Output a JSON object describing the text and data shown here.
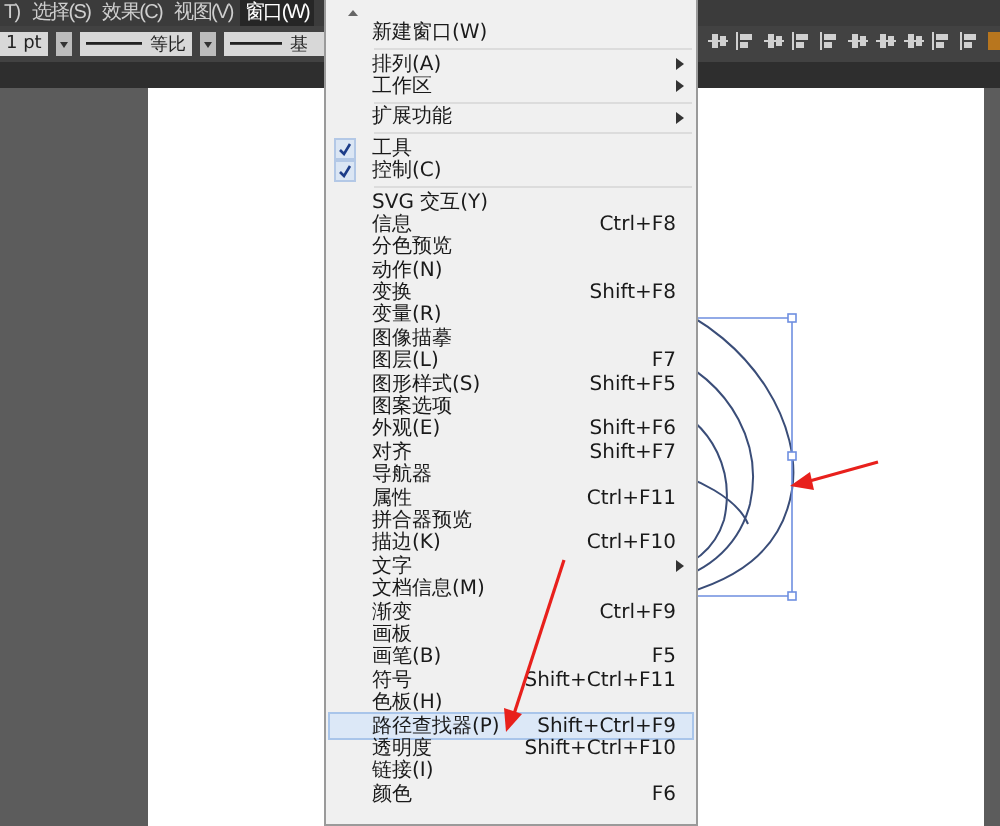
{
  "menu_bar": [
    {
      "label": "T)",
      "selected": false
    },
    {
      "label": "选择(S)",
      "selected": false
    },
    {
      "label": "效果(C)",
      "selected": false
    },
    {
      "label": "视图(V)",
      "selected": false
    },
    {
      "label": "窗口(W)",
      "selected": true
    }
  ],
  "control_bar": {
    "stroke_weight": "1 pt",
    "profile": "等比",
    "brush": "基"
  },
  "menu": {
    "items": [
      {
        "kind": "item",
        "label": "新建窗口(W)",
        "checked": false,
        "submenu": false,
        "selected": false
      },
      {
        "kind": "separator"
      },
      {
        "kind": "item",
        "label": "排列(A)",
        "checked": false,
        "submenu": true,
        "selected": false
      },
      {
        "kind": "item",
        "label": "工作区",
        "checked": false,
        "submenu": true,
        "selected": false
      },
      {
        "kind": "separator"
      },
      {
        "kind": "item",
        "label": "扩展功能",
        "checked": false,
        "submenu": true,
        "selected": false
      },
      {
        "kind": "separator"
      },
      {
        "kind": "item",
        "label": "工具",
        "checked": true,
        "submenu": false,
        "selected": false
      },
      {
        "kind": "item",
        "label": "控制(C)",
        "checked": true,
        "submenu": false,
        "selected": false
      },
      {
        "kind": "separator"
      },
      {
        "kind": "item",
        "label": "SVG 交互(Y)",
        "checked": false,
        "submenu": false,
        "selected": false
      },
      {
        "kind": "item",
        "label": "信息",
        "shortcut": "Ctrl+F8",
        "checked": false,
        "submenu": false,
        "selected": false
      },
      {
        "kind": "item",
        "label": "分色预览",
        "checked": false,
        "submenu": false,
        "selected": false
      },
      {
        "kind": "item",
        "label": "动作(N)",
        "checked": false,
        "submenu": false,
        "selected": false
      },
      {
        "kind": "item",
        "label": "变换",
        "shortcut": "Shift+F8",
        "checked": false,
        "submenu": false,
        "selected": false
      },
      {
        "kind": "item",
        "label": "变量(R)",
        "checked": false,
        "submenu": false,
        "selected": false
      },
      {
        "kind": "item",
        "label": "图像描摹",
        "checked": false,
        "submenu": false,
        "selected": false
      },
      {
        "kind": "item",
        "label": "图层(L)",
        "shortcut": "F7",
        "checked": false,
        "submenu": false,
        "selected": false
      },
      {
        "kind": "item",
        "label": "图形样式(S)",
        "shortcut": "Shift+F5",
        "checked": false,
        "submenu": false,
        "selected": false
      },
      {
        "kind": "item",
        "label": "图案选项",
        "checked": false,
        "submenu": false,
        "selected": false
      },
      {
        "kind": "item",
        "label": "外观(E)",
        "shortcut": "Shift+F6",
        "checked": false,
        "submenu": false,
        "selected": false
      },
      {
        "kind": "item",
        "label": "对齐",
        "shortcut": "Shift+F7",
        "checked": false,
        "submenu": false,
        "selected": false
      },
      {
        "kind": "item",
        "label": "导航器",
        "checked": false,
        "submenu": false,
        "selected": false
      },
      {
        "kind": "item",
        "label": "属性",
        "shortcut": "Ctrl+F11",
        "checked": false,
        "submenu": false,
        "selected": false
      },
      {
        "kind": "item",
        "label": "拼合器预览",
        "checked": false,
        "submenu": false,
        "selected": false
      },
      {
        "kind": "item",
        "label": "描边(K)",
        "shortcut": "Ctrl+F10",
        "checked": false,
        "submenu": false,
        "selected": false
      },
      {
        "kind": "item",
        "label": "文字",
        "checked": false,
        "submenu": true,
        "selected": false
      },
      {
        "kind": "item",
        "label": "文档信息(M)",
        "checked": false,
        "submenu": false,
        "selected": false
      },
      {
        "kind": "item",
        "label": "渐变",
        "shortcut": "Ctrl+F9",
        "checked": false,
        "submenu": false,
        "selected": false
      },
      {
        "kind": "item",
        "label": "画板",
        "checked": false,
        "submenu": false,
        "selected": false
      },
      {
        "kind": "item",
        "label": "画笔(B)",
        "shortcut": "F5",
        "checked": false,
        "submenu": false,
        "selected": false
      },
      {
        "kind": "item",
        "label": "符号",
        "shortcut": "Shift+Ctrl+F11",
        "checked": false,
        "submenu": false,
        "selected": false
      },
      {
        "kind": "item",
        "label": "色板(H)",
        "checked": false,
        "submenu": false,
        "selected": false
      },
      {
        "kind": "item",
        "label": "路径查找器(P)",
        "shortcut": "Shift+Ctrl+F9",
        "checked": false,
        "submenu": false,
        "selected": true
      },
      {
        "kind": "item",
        "label": "透明度",
        "shortcut": "Shift+Ctrl+F10",
        "checked": false,
        "submenu": false,
        "selected": false
      },
      {
        "kind": "item",
        "label": "链接(I)",
        "checked": false,
        "submenu": false,
        "selected": false
      },
      {
        "kind": "item",
        "label": "颜色",
        "shortcut": "F6",
        "checked": false,
        "submenu": false,
        "selected": false
      }
    ]
  }
}
